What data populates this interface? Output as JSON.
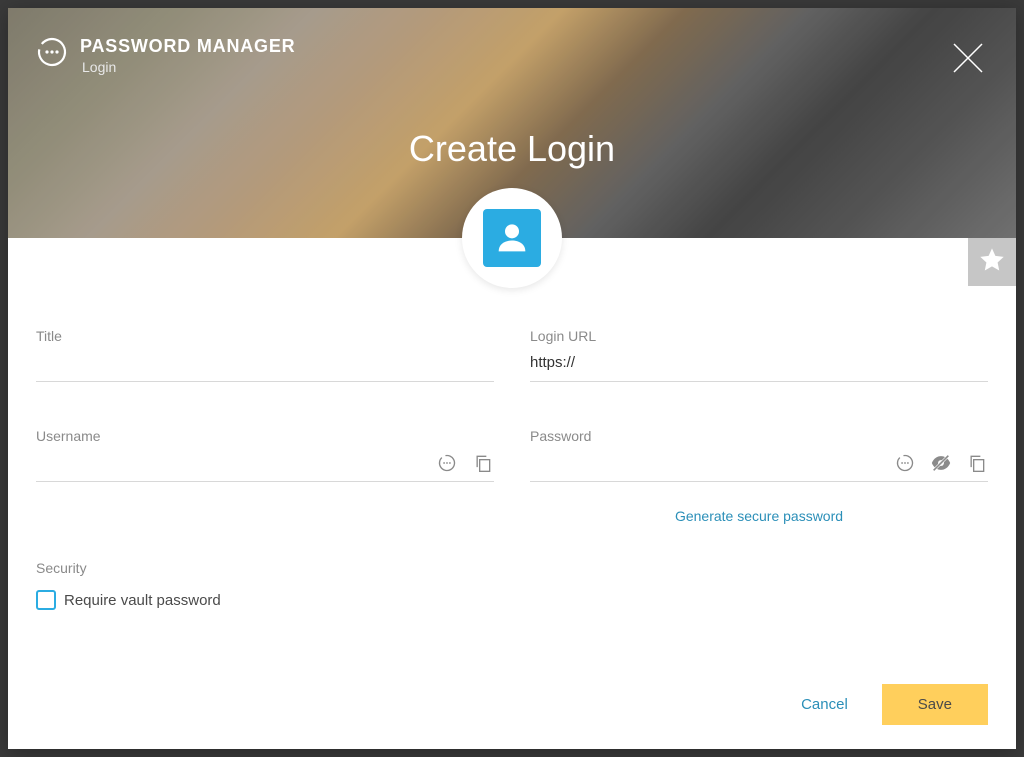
{
  "brand": {
    "title": "PASSWORD MANAGER",
    "subtitle": "Login"
  },
  "page": {
    "title": "Create Login"
  },
  "fields": {
    "title": {
      "label": "Title",
      "value": ""
    },
    "loginUrl": {
      "label": "Login URL",
      "value": "https://"
    },
    "username": {
      "label": "Username",
      "value": ""
    },
    "password": {
      "label": "Password",
      "value": ""
    }
  },
  "links": {
    "generate": "Generate secure password"
  },
  "security": {
    "heading": "Security",
    "requireVault": "Require vault password"
  },
  "buttons": {
    "cancel": "Cancel",
    "save": "Save"
  }
}
